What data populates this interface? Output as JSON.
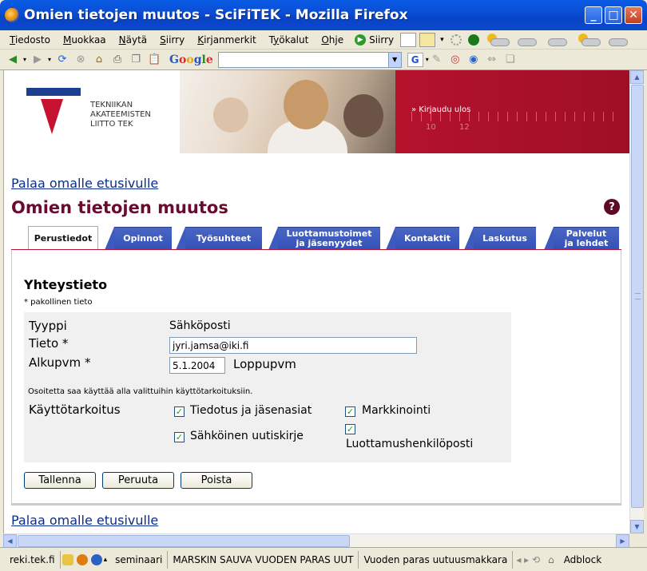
{
  "window": {
    "title": "Omien tietojen muutos - SciFiTEK - Mozilla Firefox"
  },
  "menu": {
    "items": [
      {
        "label": "Tiedosto",
        "u": "T"
      },
      {
        "label": "Muokkaa",
        "u": "M"
      },
      {
        "label": "Näytä",
        "u": "N"
      },
      {
        "label": "Siirry",
        "u": "S"
      },
      {
        "label": "Kirjanmerkit",
        "u": "K"
      },
      {
        "label": "Työkalut",
        "u": "y"
      },
      {
        "label": "Ohje",
        "u": "O"
      }
    ],
    "go_label": "Siirry"
  },
  "navbar": {
    "google_label": "Google",
    "search_value": ""
  },
  "banner": {
    "org_line1": "TEKNIIKAN",
    "org_line2": "AKATEEMISTEN",
    "org_line3": "LIITTO TEK",
    "login_text": "» Kirjaudu ulos",
    "ruler_num1": "10",
    "ruler_num2": "12"
  },
  "page": {
    "back_link_top": "Palaa omalle etusivulle",
    "back_link_bottom": "Palaa omalle etusivulle",
    "title": "Omien tietojen muutos",
    "help_label": "?"
  },
  "tabs": [
    {
      "line1": "Perustiedot",
      "line2": "",
      "active": true
    },
    {
      "line1": "Opinnot",
      "line2": ""
    },
    {
      "line1": "Työsuhteet",
      "line2": ""
    },
    {
      "line1": "Luottamustoimet",
      "line2": "ja jäsenyydet"
    },
    {
      "line1": "Kontaktit",
      "line2": ""
    },
    {
      "line1": "Laskutus",
      "line2": ""
    },
    {
      "line1": "Palvelut",
      "line2": "ja lehdet"
    }
  ],
  "form": {
    "section_title": "Yhteystieto",
    "required_note": "* pakollinen tieto",
    "type_label": "Tyyppi",
    "type_value": "Sähköposti",
    "info_label": "Tieto *",
    "info_value": "jyri.jamsa@iki.fi",
    "start_label": "Alkupvm *",
    "start_value": "5.1.2004",
    "end_label": "Loppupvm",
    "usage_note": "Osoitetta saa käyttää alla valittuihin käyttötarkoituksiin.",
    "purpose_label": "Käyttötarkoitus",
    "purposes": [
      {
        "label": "Tiedotus ja jäsenasiat",
        "checked": true
      },
      {
        "label": "Markkinointi",
        "checked": true
      },
      {
        "label": "Sähköinen uutiskirje",
        "checked": true
      },
      {
        "label": "Luottamushenkilöposti",
        "checked": true
      }
    ],
    "save_label": "Tallenna",
    "cancel_label": "Peruuta",
    "delete_label": "Poista"
  },
  "statusbar": {
    "host": "reki.tek.fi",
    "ticker1": "seminaari",
    "ticker2": "MARSKIN SAUVA VUODEN PARAS UUT",
    "ticker3": "Vuoden paras uutuusmakkara",
    "adblock": "Adblock"
  }
}
